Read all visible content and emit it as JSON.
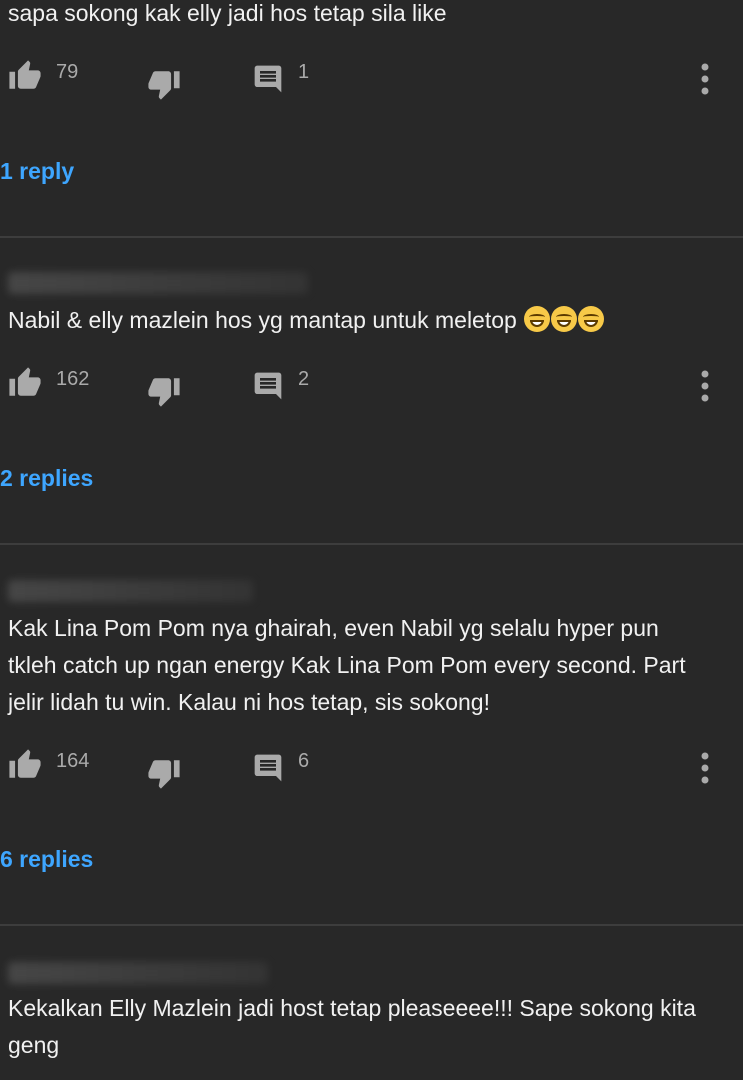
{
  "comments": [
    {
      "text": "sapa sokong kak elly jadi hos tetap sila like",
      "likes": "79",
      "replies_count": "1",
      "replies_link": "1 reply"
    },
    {
      "text": "Nabil & elly mazlein hos yg mantap untuk meletop",
      "likes": "162",
      "replies_count": "2",
      "replies_link": "2 replies"
    },
    {
      "text": "Kak Lina Pom Pom nya ghairah, even Nabil yg selalu hyper pun tkleh catch up ngan energy Kak Lina Pom Pom every second. Part jelir lidah tu win. Kalau ni hos tetap, sis sokong!",
      "likes": "164",
      "replies_count": "6",
      "replies_link": "6 replies"
    },
    {
      "text": "Kekalkan Elly Mazlein jadi host tetap pleaseeee!!! Sape sokong kita geng"
    }
  ],
  "icons": {
    "like": "thumb-up-icon",
    "dislike": "thumb-down-icon",
    "reply": "comment-icon",
    "more": "more-vert-icon",
    "emoji": "grinning-squinting-face-emoji"
  },
  "colors": {
    "background": "#282828",
    "text": "#f1f1f1",
    "secondary": "#aaaaaa",
    "link": "#3ea6ff",
    "divider": "#3d3d3d"
  }
}
